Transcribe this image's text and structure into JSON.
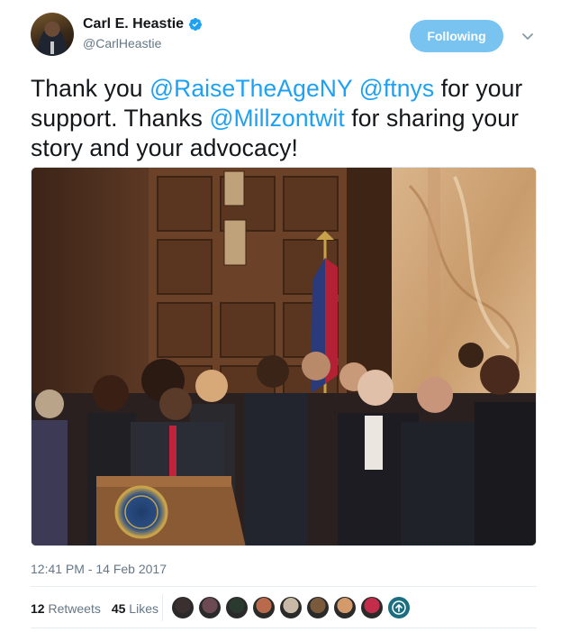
{
  "author": {
    "display_name": "Carl E. Heastie",
    "handle": "@CarlHeastie",
    "verified": true
  },
  "follow_button": {
    "label": "Following"
  },
  "tweet": {
    "parts": [
      {
        "text": "Thank you ",
        "mention": false
      },
      {
        "text": "@RaiseTheAgeNY",
        "mention": true
      },
      {
        "text": " ",
        "mention": false
      },
      {
        "text": "@ftnys",
        "mention": true
      },
      {
        "text": " for your support. Thanks ",
        "mention": false
      },
      {
        "text": "@Millzontwit",
        "mention": true
      },
      {
        "text": " for sharing your story and your advocacy!",
        "mention": false
      }
    ],
    "timestamp": "12:41 PM - 14 Feb 2017"
  },
  "stats": {
    "retweets_count": "12",
    "retweets_label": "Retweets",
    "likes_count": "45",
    "likes_label": "Likes"
  },
  "likers": [
    {
      "name": "liker-1",
      "color": "#3a3030"
    },
    {
      "name": "liker-2",
      "color": "#6c4a52"
    },
    {
      "name": "liker-3",
      "color": "#2b3a2f"
    },
    {
      "name": "liker-4",
      "color": "#b86a4a"
    },
    {
      "name": "liker-5",
      "color": "#c7b9a5"
    },
    {
      "name": "liker-6",
      "color": "#7a5a3a"
    },
    {
      "name": "liker-7",
      "color": "#d59a6a"
    },
    {
      "name": "liker-8",
      "color": "#c42d4a"
    }
  ],
  "colors": {
    "accent": "#1da1f2",
    "follow_button": "#78c3f0",
    "verified": "#1da1f2",
    "secondary_text": "#657786"
  }
}
